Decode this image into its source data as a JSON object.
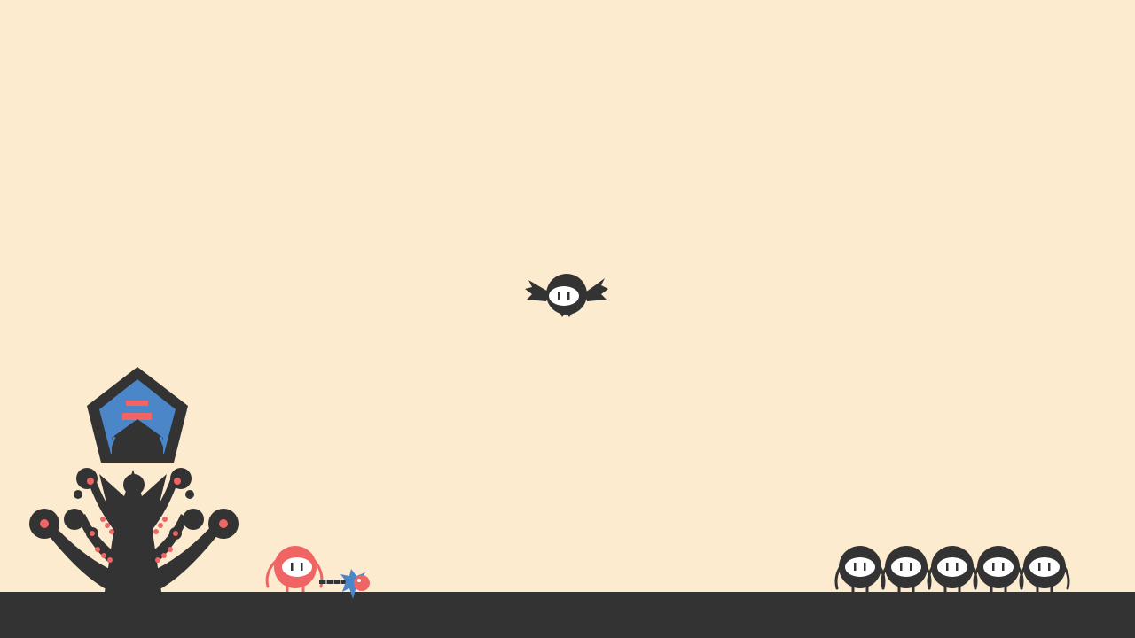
{
  "scene": {
    "background_color": "#FDEBD0",
    "ground_color": "#333333",
    "dark_color": "#333333",
    "accent_color": "#F06464",
    "blue_color": "#4A86C8",
    "eye_white": "#FFFFFF"
  },
  "base": {
    "icon": "dark-tree-tower-icon",
    "roof_icon": "pentagon-banner-icon"
  },
  "player": {
    "icon": "red-blob-hero-icon",
    "weapon_icon": "mace-weapon-icon"
  },
  "flying_enemy": {
    "icon": "bat-enemy-icon"
  },
  "enemy_group": {
    "count": 5,
    "icon": "dark-blob-enemy-icon"
  }
}
